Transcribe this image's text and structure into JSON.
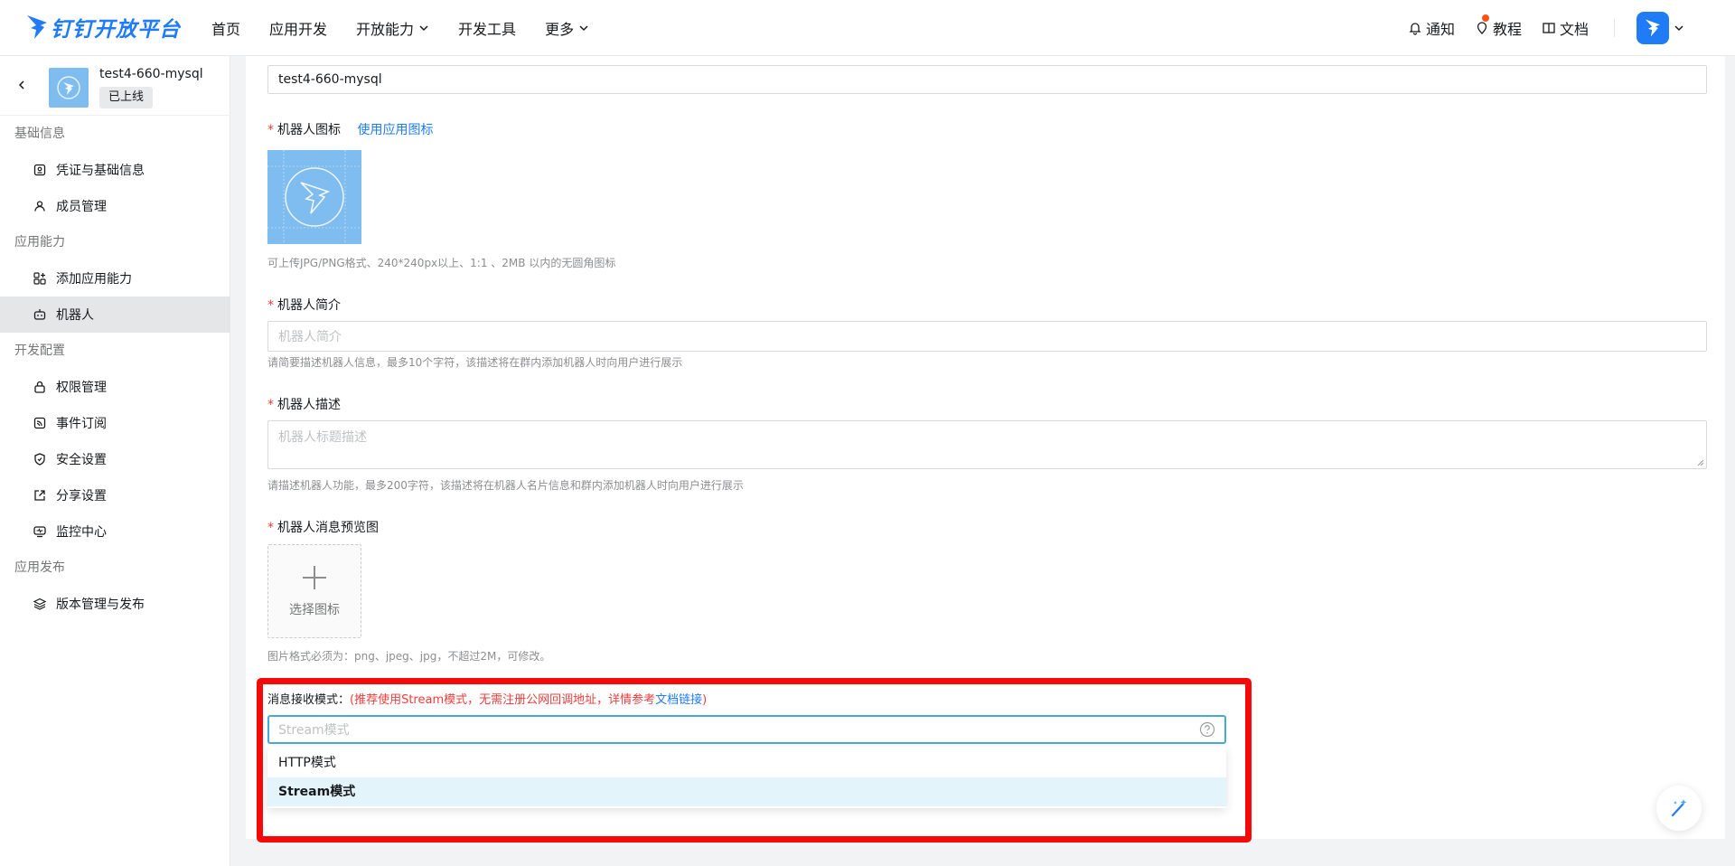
{
  "brand": {
    "name": "钉钉开放平台",
    "color": "#1f7cf6"
  },
  "nav": {
    "items": [
      {
        "label": "首页",
        "dropdown": false
      },
      {
        "label": "应用开发",
        "dropdown": false
      },
      {
        "label": "开放能力",
        "dropdown": true
      },
      {
        "label": "开发工具",
        "dropdown": false
      },
      {
        "label": "更多",
        "dropdown": true
      }
    ],
    "notify_label": "通知",
    "tutorial_label": "教程",
    "docs_label": "文档"
  },
  "app": {
    "name": "test4-660-mysql",
    "status": "已上线"
  },
  "sidebar": {
    "group_basic": "基础信息",
    "item_credentials": "凭证与基础信息",
    "item_members": "成员管理",
    "group_capability": "应用能力",
    "item_add_capability": "添加应用能力",
    "item_robot": "机器人",
    "group_dev": "开发配置",
    "item_permission": "权限管理",
    "item_events": "事件订阅",
    "item_security": "安全设置",
    "item_share": "分享设置",
    "item_monitor": "监控中心",
    "group_release": "应用发布",
    "item_version": "版本管理与发布"
  },
  "form": {
    "robot_name_value": "test4-660-mysql",
    "robot_icon_label": "机器人图标",
    "use_app_icon_link": "使用应用图标",
    "robot_icon_hint": "可上传JPG/PNG格式、240*240px以上、1:1 、2MB 以内的无圆角图标",
    "intro_label": "机器人简介",
    "intro_placeholder": "机器人简介",
    "intro_hint": "请简要描述机器人信息，最多10个字符，该描述将在群内添加机器人时向用户进行展示",
    "desc_label": "机器人描述",
    "desc_placeholder": "机器人标题描述",
    "desc_hint": "请描述机器人功能，最多200字符，该描述将在机器人名片信息和群内添加机器人时向用户进行展示",
    "preview_label": "机器人消息预览图",
    "preview_upload_text": "选择图标",
    "preview_hint": "图片格式必须为：png、jpeg、jpg，不超过2M，可修改。",
    "mode_label": "消息接收模式：",
    "mode_tip_prefix": "(推荐使用Stream模式，无需注册公网回调地址，详情参考",
    "mode_tip_link": "文档链接",
    "mode_tip_suffix": ")",
    "mode_placeholder": "Stream模式",
    "mode_options": [
      "HTTP模式",
      "Stream模式"
    ],
    "mode_selected": "Stream模式"
  },
  "colors": {
    "accent": "#1f7cf6",
    "required": "#f23c3c",
    "highlight": "#f50a0a",
    "selected_option_bg": "#e4f4fb"
  }
}
